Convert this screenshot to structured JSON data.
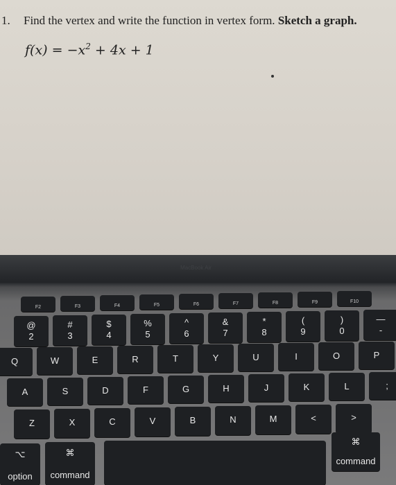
{
  "worksheet": {
    "question_number": "1.",
    "instruction": "Find the vertex and write the function in vertex form.",
    "instruction_bold": "Sketch a graph.",
    "formula_lhs": "f(x) = −x",
    "formula_exp": "2",
    "formula_rhs": " + 4x + 1"
  },
  "laptop": {
    "brand": "MacBook Air",
    "function_row": [
      "F2",
      "F3",
      "F4",
      "F5",
      "F6",
      "F7",
      "F8",
      "F9",
      "F10"
    ],
    "number_row": [
      {
        "top": "@",
        "bottom": "2"
      },
      {
        "top": "#",
        "bottom": "3"
      },
      {
        "top": "$",
        "bottom": "4"
      },
      {
        "top": "%",
        "bottom": "5"
      },
      {
        "top": "^",
        "bottom": "6"
      },
      {
        "top": "&",
        "bottom": "7"
      },
      {
        "top": "*",
        "bottom": "8"
      },
      {
        "top": "(",
        "bottom": "9"
      },
      {
        "top": ")",
        "bottom": "0"
      },
      {
        "top": "—",
        "bottom": "-"
      }
    ],
    "row_q": [
      "Q",
      "W",
      "E",
      "R",
      "T",
      "Y",
      "U",
      "I",
      "O",
      "P"
    ],
    "row_a": [
      "A",
      "S",
      "D",
      "F",
      "G",
      "H",
      "J",
      "K",
      "L",
      ";"
    ],
    "row_z": [
      "Z",
      "X",
      "C",
      "V",
      "B",
      "N",
      "M",
      "<",
      ">"
    ],
    "mods": {
      "option_symbol": "⌥",
      "option": "option",
      "cmd_symbol": "⌘",
      "command": "command"
    }
  }
}
